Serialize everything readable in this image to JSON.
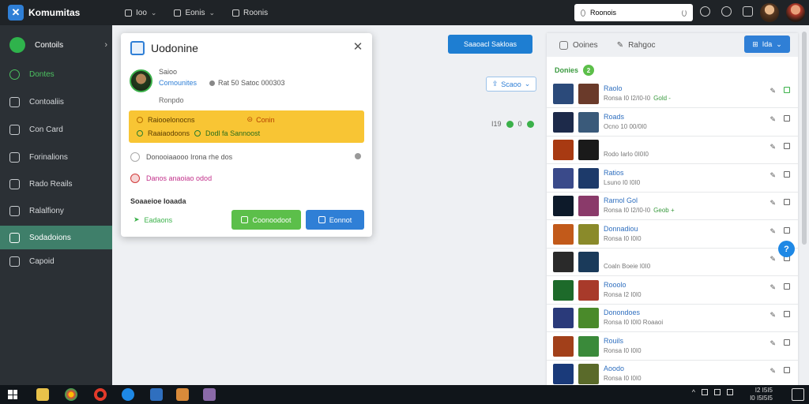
{
  "topbar": {
    "brand": "Komumitas",
    "nav": [
      {
        "label": "Ioo",
        "icon": "home-icon"
      },
      {
        "label": "Eonis",
        "icon": "grid-icon"
      },
      {
        "label": "Roonis",
        "icon": "list-icon"
      }
    ],
    "search_value": "Roonois"
  },
  "sidebar": {
    "items": [
      {
        "label": "Contoils",
        "icon": "home-icon"
      },
      {
        "label": "Dontes",
        "icon": "target-icon"
      },
      {
        "label": "Contoaliis",
        "icon": "chat-icon"
      },
      {
        "label": "Con Card",
        "icon": "card-icon"
      },
      {
        "label": "Forinalions",
        "icon": "chart-icon"
      },
      {
        "label": "Rado Reails",
        "icon": "edit-icon"
      },
      {
        "label": "Ralalfiony",
        "icon": "folder-icon"
      },
      {
        "label": "Sodadoions",
        "icon": "stats-icon"
      },
      {
        "label": "Capoid",
        "icon": "settings-icon"
      }
    ],
    "active_index": 7
  },
  "main": {
    "primary_button": "Saaoacl Sakloas",
    "share_button": "Scaoo",
    "stats": [
      "I19",
      "0"
    ]
  },
  "dialog": {
    "title": "Uodonine",
    "status": "Saioo",
    "role": "Comounites",
    "meta": "Rat 50 Satoc 000303",
    "subtitle": "Ronpdo",
    "banner_row1_text": "Raiooelonocns",
    "banner_row1_link": "Conin",
    "banner_row2_text": "Raaiaodoons",
    "banner_row2_tag": "Dodl fa Sannoost",
    "line1": "Donooiaaooo Irona rhe dos",
    "line2": "Danos anaoiao odod",
    "section": "Soaaeioe Ioaada",
    "footer_link": "Eadaons",
    "btn_green": "Coonoodoot",
    "btn_blue": "Eonnot"
  },
  "rpanel": {
    "tabs": [
      "Ooines",
      "Rahgoc"
    ],
    "dropdown": "Ida",
    "header": "Donies",
    "header_count": "2",
    "rows": [
      {
        "title": "Raolo",
        "sub": "Ronsa I0 I2/I0-I0",
        "tag": "Gold -",
        "thumb1": "#2b4a7a",
        "thumb2": "#6a3a2a"
      },
      {
        "title": "Roads",
        "sub": "Ocno 10 00/0I0",
        "tag": "",
        "thumb1": "#1d2a4a",
        "thumb2": "#3a5a7a"
      },
      {
        "title": "",
        "sub": "Rodo Iarlo 0I0I0",
        "tag": "",
        "thumb1": "#a83a12",
        "thumb2": "#1a1a1a"
      },
      {
        "title": "Ratios",
        "sub": "Lsuno I0 I0I0",
        "tag": "",
        "thumb1": "#3a4a8a",
        "thumb2": "#1d3a6a"
      },
      {
        "title": "Rarnol Gol",
        "sub": "Ronsa I0 I2/I0-I0",
        "tag": "Geob +",
        "thumb1": "#0d1a2a",
        "thumb2": "#8a3a6a"
      },
      {
        "title": "Donnadiou",
        "sub": "Ronsa I0 I0I0",
        "tag": "",
        "thumb1": "#c25a1a",
        "thumb2": "#8a8a2a"
      },
      {
        "title": "",
        "sub": "Coaln Boeie I0I0",
        "tag": "",
        "thumb1": "#2a2a2a",
        "thumb2": "#1a3a5a"
      },
      {
        "title": "Rooolo",
        "sub": "Ronsa I2 I0I0",
        "tag": "",
        "thumb1": "#1d6a2a",
        "thumb2": "#a83a2a"
      },
      {
        "title": "Donondoes",
        "sub": "Ronsa I0 I0I0 Roaaoi",
        "tag": "",
        "thumb1": "#2a3a7a",
        "thumb2": "#4a8a2a"
      },
      {
        "title": "Rouils",
        "sub": "Ronsa I0 I0I0",
        "tag": "",
        "thumb1": "#a2401a",
        "thumb2": "#3a8a3a"
      },
      {
        "title": "Aoodo",
        "sub": "Ronsa I0 I0I0",
        "tag": "",
        "thumb1": "#1a3a7a",
        "thumb2": "#5a6a2a"
      }
    ]
  },
  "taskbar": {
    "clock_line1": "I2 I5I5",
    "clock_line2": "I0 I5I5I5"
  },
  "colors": {
    "sidebar_bg": "#2b3035",
    "sidebar_active": "#3f7f6a",
    "accent_blue": "#2f7fd6",
    "accent_green": "#5cbf4a",
    "banner_yellow": "#f8c534"
  }
}
